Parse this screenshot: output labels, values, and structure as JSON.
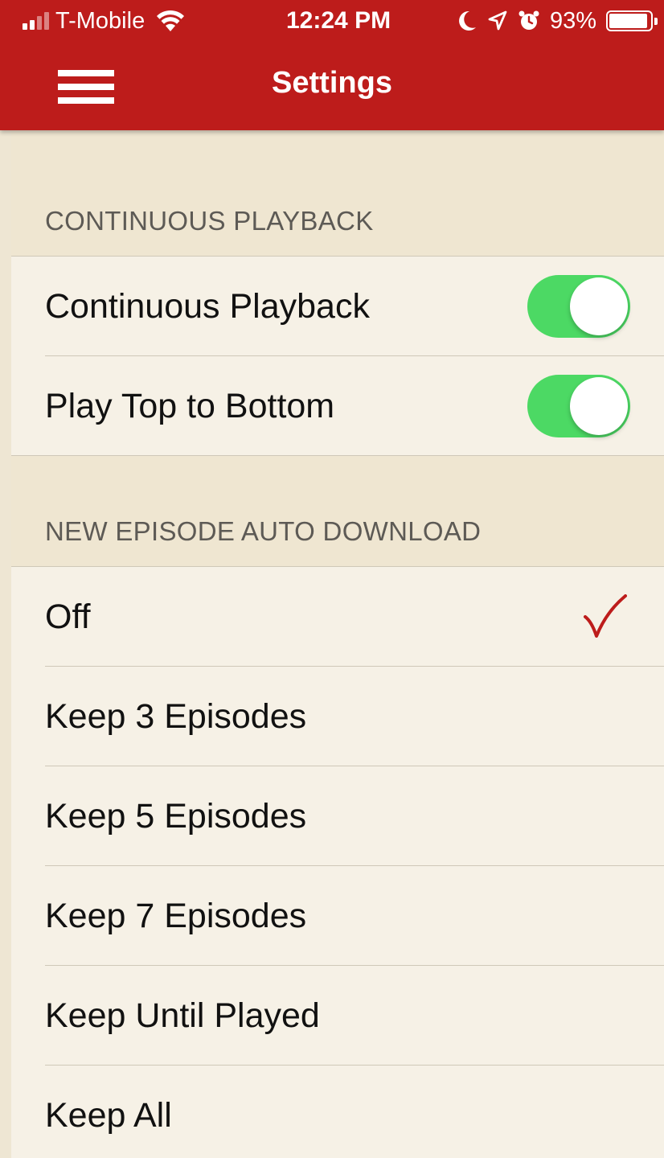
{
  "status_bar": {
    "carrier": "T-Mobile",
    "time": "12:24 PM",
    "battery_percent": "93%",
    "battery_level": 0.93,
    "icons": [
      "signal-icon",
      "wifi-icon",
      "moon-icon",
      "location-icon",
      "alarm-icon",
      "battery-icon"
    ]
  },
  "nav": {
    "title": "Settings",
    "menu_icon": "hamburger-menu-icon"
  },
  "colors": {
    "header_red": "#bd1c1b",
    "toggle_on": "#4cd964",
    "checkmark": "#bd1c1b",
    "background": "#f6f1e6",
    "section_background": "#efe6d1"
  },
  "sections": [
    {
      "header": "CONTINUOUS PLAYBACK",
      "rows": [
        {
          "label": "Continuous Playback",
          "toggle_on": true
        },
        {
          "label": "Play Top to Bottom",
          "toggle_on": true
        }
      ]
    },
    {
      "header": "NEW EPISODE AUTO DOWNLOAD",
      "selected": "Off",
      "rows": [
        {
          "label": "Off",
          "checked": true
        },
        {
          "label": "Keep 3 Episodes",
          "checked": false
        },
        {
          "label": "Keep 5 Episodes",
          "checked": false
        },
        {
          "label": "Keep 7 Episodes",
          "checked": false
        },
        {
          "label": "Keep Until Played",
          "checked": false
        },
        {
          "label": "Keep All",
          "checked": false
        }
      ]
    }
  ]
}
